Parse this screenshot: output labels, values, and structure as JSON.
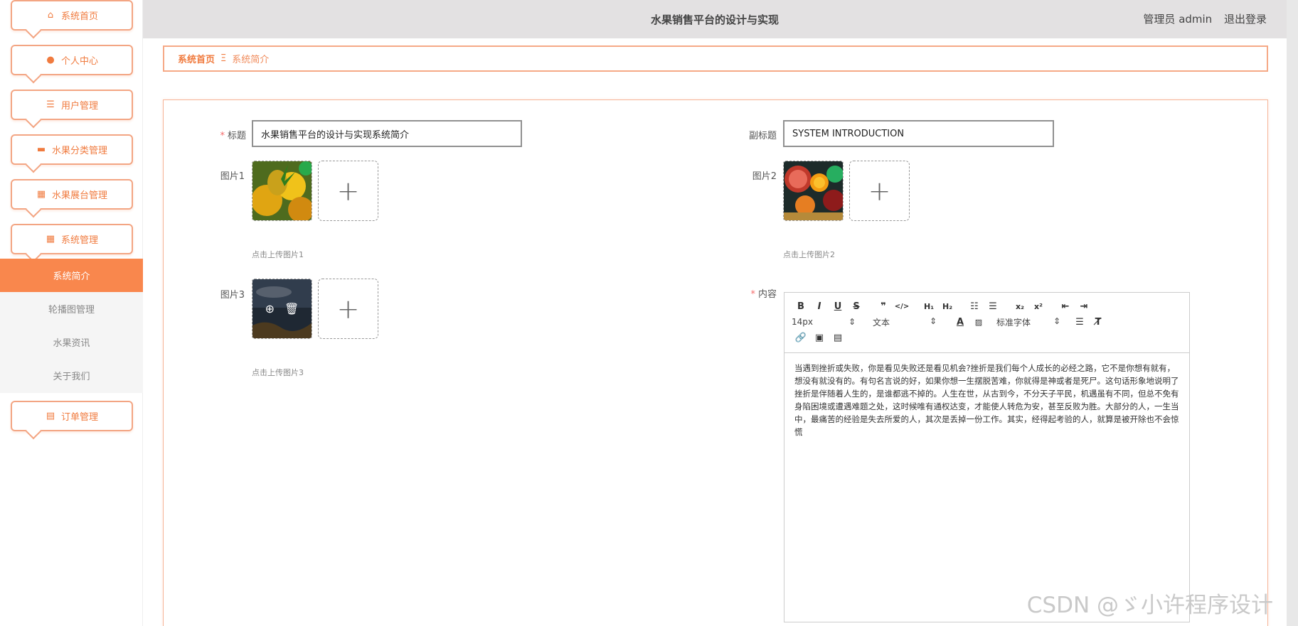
{
  "header": {
    "title": "水果销售平台的设计与实现",
    "admin": "管理员 admin",
    "logout": "退出登录"
  },
  "sidebar": {
    "items": [
      {
        "label": "系统首页",
        "icon": "home-icon"
      },
      {
        "label": "个人中心",
        "icon": "user-icon"
      },
      {
        "label": "用户管理",
        "icon": "list-icon"
      },
      {
        "label": "水果分类管理",
        "icon": "briefcase-icon"
      },
      {
        "label": "水果展台管理",
        "icon": "grid-icon"
      },
      {
        "label": "系统管理",
        "icon": "grid-icon"
      },
      {
        "label": "订单管理",
        "icon": "clipboard-icon"
      }
    ],
    "subitems": [
      {
        "label": "系统简介",
        "active": true
      },
      {
        "label": "轮播图管理"
      },
      {
        "label": "水果资讯"
      },
      {
        "label": "关于我们"
      }
    ]
  },
  "breadcrumb": {
    "home": "系统首页",
    "sep": "Ξ",
    "current": "系统简介"
  },
  "form": {
    "title_label": "标题",
    "title_value": "水果销售平台的设计与实现系统简介",
    "subtitle_label": "副标题",
    "subtitle_value": "SYSTEM INTRODUCTION",
    "img1_label": "图片1",
    "img1_hint": "点击上传图片1",
    "img2_label": "图片2",
    "img2_hint": "点击上传图片2",
    "img3_label": "图片3",
    "img3_hint": "点击上传图片3",
    "content_label": "内容"
  },
  "editor": {
    "font_size": "14px",
    "text_type": "文本",
    "font_family": "标准字体",
    "content": "当遇到挫折或失败，你是看见失败还是看见机会?挫折是我们每个人成长的必经之路，它不是你想有就有，想没有就没有的。有句名言说的好，如果你想一生摆脱苦难，你就得是神或者是死尸。这句话形象地说明了挫折是伴随着人生的，是谁都逃不掉的。人生在世，从古到今，不分天子平民，机遇虽有不同，但总不免有身陷困境或遭遇难题之处，这时候唯有通权达变，才能使人转危为安，甚至反败为胜。大部分的人，一生当中，最痛苦的经验是失去所爱的人，其次是丢掉一份工作。其实，经得起考验的人，就算是被开除也不会惊慌"
  },
  "watermark": "CSDN @ゞ小许程序设计"
}
